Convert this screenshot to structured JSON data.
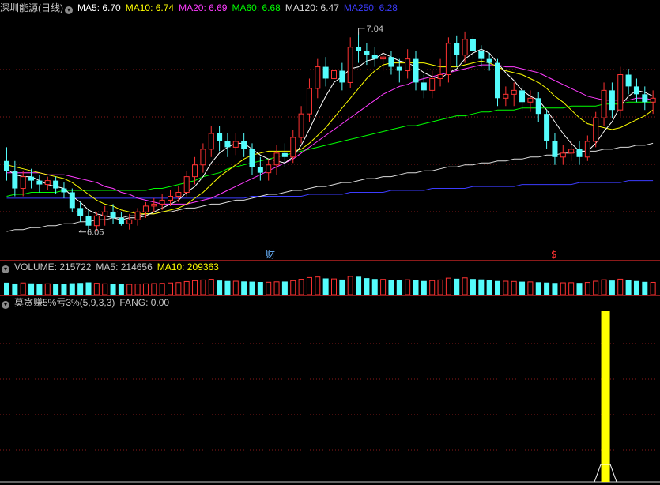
{
  "price_header": {
    "name": "深圳能源",
    "period": "(日线)",
    "ma": [
      {
        "label": "MA5: 6.70",
        "color": "#ffffff"
      },
      {
        "label": "MA10: 6.74",
        "color": "#ffff00"
      },
      {
        "label": "MA20: 6.69",
        "color": "#ff3cff"
      },
      {
        "label": "MA60: 6.68",
        "color": "#00ff00"
      },
      {
        "label": "MA120: 6.47",
        "color": "#dcdcdc"
      },
      {
        "label": "MA250: 6.28",
        "color": "#3c3cff"
      }
    ]
  },
  "volume_header": {
    "volume": "VOLUME: 215722",
    "ma5": "MA5: 214656",
    "ma10": "MA10: 209363"
  },
  "indicator_header": {
    "name": "莫贪赚5%亏3%(5,9,3,3)",
    "value": "FANG: 0.00"
  },
  "markers": {
    "finance": "财",
    "dividend": "$"
  },
  "colors": {
    "up": "#ff3232",
    "down": "#54fcfc",
    "grid": "#8b1a1a",
    "signal": "#ffff00"
  },
  "chart_data": [
    {
      "type": "candlestick",
      "high_label": "7.04",
      "low_label": "6.05",
      "high_value": 7.04,
      "low_value": 6.05,
      "y_range": [
        5.92,
        7.12
      ],
      "candles": [
        [
          6.38,
          6.33,
          6.45,
          6.28
        ],
        [
          6.33,
          6.24,
          6.38,
          6.2
        ],
        [
          6.24,
          6.3,
          6.33,
          6.2
        ],
        [
          6.3,
          6.28,
          6.34,
          6.24
        ],
        [
          6.28,
          6.26,
          6.31,
          6.22
        ],
        [
          6.26,
          6.28,
          6.3,
          6.23
        ],
        [
          6.28,
          6.24,
          6.3,
          6.21
        ],
        [
          6.24,
          6.22,
          6.27,
          6.19
        ],
        [
          6.22,
          6.14,
          6.24,
          6.12
        ],
        [
          6.14,
          6.1,
          6.17,
          6.07
        ],
        [
          6.1,
          6.05,
          6.13,
          6.02
        ],
        [
          6.05,
          6.1,
          6.12,
          6.02
        ],
        [
          6.1,
          6.12,
          6.15,
          6.05
        ],
        [
          6.12,
          6.09,
          6.16,
          6.06
        ],
        [
          6.09,
          6.06,
          6.12,
          6.05
        ],
        [
          6.06,
          6.08,
          6.11,
          6.03
        ],
        [
          6.08,
          6.12,
          6.14,
          6.05
        ],
        [
          6.12,
          6.15,
          6.17,
          6.09
        ],
        [
          6.15,
          6.16,
          6.19,
          6.12
        ],
        [
          6.16,
          6.18,
          6.21,
          6.13
        ],
        [
          6.18,
          6.2,
          6.23,
          6.15
        ],
        [
          6.2,
          6.22,
          6.25,
          6.17
        ],
        [
          6.22,
          6.3,
          6.33,
          6.2
        ],
        [
          6.3,
          6.36,
          6.4,
          6.26
        ],
        [
          6.36,
          6.44,
          6.47,
          6.32
        ],
        [
          6.44,
          6.52,
          6.56,
          6.4
        ],
        [
          6.52,
          6.48,
          6.56,
          6.43
        ],
        [
          6.48,
          6.45,
          6.52,
          6.4
        ],
        [
          6.45,
          6.48,
          6.52,
          6.41
        ],
        [
          6.48,
          6.44,
          6.52,
          6.4
        ],
        [
          6.44,
          6.35,
          6.47,
          6.31
        ],
        [
          6.35,
          6.32,
          6.4,
          6.28
        ],
        [
          6.32,
          6.36,
          6.39,
          6.28
        ],
        [
          6.36,
          6.42,
          6.46,
          6.31
        ],
        [
          6.42,
          6.4,
          6.47,
          6.35
        ],
        [
          6.4,
          6.5,
          6.54,
          6.37
        ],
        [
          6.5,
          6.62,
          6.66,
          6.47
        ],
        [
          6.62,
          6.75,
          6.8,
          6.58
        ],
        [
          6.75,
          6.86,
          6.9,
          6.7
        ],
        [
          6.86,
          6.8,
          6.91,
          6.76
        ],
        [
          6.8,
          6.84,
          6.88,
          6.74
        ],
        [
          6.84,
          6.78,
          6.88,
          6.74
        ],
        [
          6.78,
          6.96,
          7.01,
          6.75
        ],
        [
          6.96,
          6.94,
          7.04,
          6.88
        ],
        [
          6.94,
          6.92,
          6.98,
          6.87
        ],
        [
          6.92,
          6.9,
          6.96,
          6.86
        ],
        [
          6.9,
          6.91,
          6.94,
          6.84
        ],
        [
          6.91,
          6.86,
          6.94,
          6.82
        ],
        [
          6.86,
          6.84,
          6.9,
          6.78
        ],
        [
          6.84,
          6.9,
          6.95,
          6.8
        ],
        [
          6.9,
          6.78,
          6.94,
          6.74
        ],
        [
          6.78,
          6.74,
          6.82,
          6.7
        ],
        [
          6.74,
          6.8,
          6.84,
          6.7
        ],
        [
          6.8,
          6.82,
          6.9,
          6.76
        ],
        [
          6.82,
          6.98,
          7.01,
          6.78
        ],
        [
          6.98,
          6.92,
          7.02,
          6.86
        ],
        [
          6.92,
          7.0,
          7.04,
          6.88
        ],
        [
          7.0,
          6.94,
          7.02,
          6.9
        ],
        [
          6.94,
          6.9,
          6.97,
          6.86
        ],
        [
          6.9,
          6.88,
          6.93,
          6.84
        ],
        [
          6.88,
          6.7,
          6.9,
          6.66
        ],
        [
          6.7,
          6.72,
          6.76,
          6.66
        ],
        [
          6.72,
          6.74,
          6.78,
          6.66
        ],
        [
          6.74,
          6.68,
          6.77,
          6.64
        ],
        [
          6.68,
          6.7,
          6.74,
          6.63
        ],
        [
          6.7,
          6.62,
          6.73,
          6.58
        ],
        [
          6.62,
          6.48,
          6.64,
          6.44
        ],
        [
          6.48,
          6.4,
          6.52,
          6.36
        ],
        [
          6.4,
          6.42,
          6.46,
          6.36
        ],
        [
          6.42,
          6.44,
          6.48,
          6.38
        ],
        [
          6.44,
          6.4,
          6.48,
          6.36
        ],
        [
          6.4,
          6.48,
          6.51,
          6.38
        ],
        [
          6.48,
          6.6,
          6.63,
          6.45
        ],
        [
          6.6,
          6.74,
          6.78,
          6.56
        ],
        [
          6.74,
          6.64,
          6.78,
          6.6
        ],
        [
          6.64,
          6.82,
          6.86,
          6.6
        ],
        [
          6.82,
          6.76,
          6.85,
          6.72
        ],
        [
          6.76,
          6.72,
          6.8,
          6.68
        ],
        [
          6.72,
          6.68,
          6.76,
          6.64
        ],
        [
          6.68,
          6.7,
          6.74,
          6.62
        ]
      ],
      "ma5": [
        6.34,
        6.31,
        6.3,
        6.3,
        6.28,
        6.26,
        6.25,
        6.24,
        6.2,
        6.17,
        6.13,
        6.11,
        6.1,
        6.09,
        6.08,
        6.09,
        6.09,
        6.1,
        6.12,
        6.14,
        6.16,
        6.18,
        6.22,
        6.25,
        6.3,
        6.37,
        6.42,
        6.45,
        6.47,
        6.47,
        6.44,
        6.41,
        6.39,
        6.38,
        6.37,
        6.4,
        6.46,
        6.54,
        6.63,
        6.71,
        6.78,
        6.81,
        6.85,
        6.86,
        6.89,
        6.9,
        6.93,
        6.91,
        6.89,
        6.88,
        6.86,
        6.83,
        6.81,
        6.8,
        6.83,
        6.85,
        6.9,
        6.93,
        6.95,
        6.93,
        6.88,
        6.83,
        6.79,
        6.74,
        6.71,
        6.69,
        6.64,
        6.58,
        6.52,
        6.47,
        6.43,
        6.43,
        6.47,
        6.53,
        6.58,
        6.66,
        6.71,
        6.74,
        6.73,
        6.71
      ],
      "ma10": [
        6.36,
        6.35,
        6.34,
        6.33,
        6.32,
        6.31,
        6.3,
        6.29,
        6.27,
        6.24,
        6.21,
        6.18,
        6.16,
        6.15,
        6.13,
        6.12,
        6.11,
        6.11,
        6.11,
        6.12,
        6.13,
        6.14,
        6.16,
        6.19,
        6.22,
        6.26,
        6.3,
        6.33,
        6.36,
        6.39,
        6.41,
        6.42,
        6.43,
        6.43,
        6.43,
        6.43,
        6.44,
        6.47,
        6.51,
        6.55,
        6.6,
        6.65,
        6.7,
        6.75,
        6.8,
        6.84,
        6.87,
        6.88,
        6.88,
        6.88,
        6.88,
        6.88,
        6.87,
        6.86,
        6.86,
        6.86,
        6.87,
        6.88,
        6.89,
        6.88,
        6.86,
        6.84,
        6.83,
        6.82,
        6.8,
        6.78,
        6.75,
        6.71,
        6.68,
        6.64,
        6.6,
        6.57,
        6.56,
        6.55,
        6.54,
        6.55,
        6.57,
        6.59,
        6.61,
        6.64
      ],
      "ma20": [
        6.32,
        6.32,
        6.32,
        6.32,
        6.32,
        6.31,
        6.31,
        6.31,
        6.3,
        6.29,
        6.28,
        6.27,
        6.25,
        6.24,
        6.22,
        6.21,
        6.19,
        6.18,
        6.17,
        6.16,
        6.16,
        6.16,
        6.16,
        6.17,
        6.18,
        6.19,
        6.21,
        6.23,
        6.25,
        6.27,
        6.29,
        6.31,
        6.33,
        6.35,
        6.37,
        6.39,
        6.42,
        6.45,
        6.48,
        6.51,
        6.54,
        6.57,
        6.6,
        6.63,
        6.66,
        6.69,
        6.72,
        6.74,
        6.76,
        6.77,
        6.79,
        6.8,
        6.81,
        6.82,
        6.83,
        6.84,
        6.85,
        6.86,
        6.87,
        6.87,
        6.87,
        6.86,
        6.86,
        6.85,
        6.84,
        6.83,
        6.81,
        6.79,
        6.77,
        6.75,
        6.73,
        6.71,
        6.7,
        6.69,
        6.69,
        6.69,
        6.69,
        6.7,
        6.7,
        6.69
      ],
      "ma60": [
        6.2,
        6.21,
        6.21,
        6.22,
        6.22,
        6.22,
        6.22,
        6.23,
        6.23,
        6.23,
        6.23,
        6.23,
        6.23,
        6.23,
        6.23,
        6.23,
        6.23,
        6.23,
        6.24,
        6.24,
        6.25,
        6.26,
        6.27,
        6.28,
        6.3,
        6.31,
        6.32,
        6.34,
        6.35,
        6.36,
        6.37,
        6.38,
        6.39,
        6.4,
        6.41,
        6.42,
        6.43,
        6.44,
        6.45,
        6.46,
        6.47,
        6.48,
        6.49,
        6.5,
        6.51,
        6.52,
        6.53,
        6.54,
        6.55,
        6.56,
        6.56,
        6.57,
        6.58,
        6.59,
        6.6,
        6.61,
        6.61,
        6.62,
        6.63,
        6.63,
        6.64,
        6.64,
        6.64,
        6.65,
        6.65,
        6.65,
        6.65,
        6.65,
        6.65,
        6.66,
        6.66,
        6.66,
        6.66,
        6.67,
        6.67,
        6.67,
        6.68,
        6.68,
        6.68,
        6.68
      ],
      "ma120": [
        6.02,
        6.03,
        6.03,
        6.04,
        6.04,
        6.05,
        6.05,
        6.06,
        6.06,
        6.07,
        6.07,
        6.08,
        6.08,
        6.09,
        6.09,
        6.1,
        6.1,
        6.11,
        6.11,
        6.12,
        6.12,
        6.13,
        6.14,
        6.14,
        6.15,
        6.16,
        6.16,
        6.17,
        6.18,
        6.18,
        6.19,
        6.2,
        6.21,
        6.21,
        6.22,
        6.23,
        6.23,
        6.24,
        6.25,
        6.25,
        6.26,
        6.27,
        6.27,
        6.28,
        6.29,
        6.29,
        6.3,
        6.3,
        6.31,
        6.32,
        6.32,
        6.33,
        6.33,
        6.34,
        6.35,
        6.35,
        6.36,
        6.36,
        6.37,
        6.37,
        6.38,
        6.38,
        6.39,
        6.39,
        6.4,
        6.4,
        6.41,
        6.41,
        6.42,
        6.42,
        6.43,
        6.43,
        6.43,
        6.44,
        6.44,
        6.45,
        6.45,
        6.46,
        6.46,
        6.47
      ],
      "ma250": [
        6.19,
        6.19,
        6.19,
        6.19,
        6.19,
        6.19,
        6.19,
        6.19,
        6.19,
        6.19,
        6.19,
        6.19,
        6.19,
        6.19,
        6.19,
        6.19,
        6.19,
        6.19,
        6.19,
        6.19,
        6.19,
        6.19,
        6.19,
        6.19,
        6.19,
        6.19,
        6.19,
        6.19,
        6.19,
        6.19,
        6.2,
        6.2,
        6.2,
        6.2,
        6.2,
        6.2,
        6.2,
        6.21,
        6.21,
        6.21,
        6.21,
        6.21,
        6.22,
        6.22,
        6.22,
        6.22,
        6.22,
        6.23,
        6.23,
        6.23,
        6.23,
        6.23,
        6.24,
        6.24,
        6.24,
        6.24,
        6.24,
        6.25,
        6.25,
        6.25,
        6.25,
        6.25,
        6.25,
        6.26,
        6.26,
        6.26,
        6.26,
        6.26,
        6.26,
        6.26,
        6.27,
        6.27,
        6.27,
        6.27,
        6.27,
        6.27,
        6.28,
        6.28,
        6.28,
        6.28
      ]
    },
    {
      "type": "bar",
      "volumes": [
        210000,
        195000,
        205000,
        198000,
        188000,
        190000,
        186000,
        184000,
        200000,
        205000,
        215000,
        199000,
        190000,
        185000,
        182000,
        180000,
        186000,
        190000,
        194000,
        198000,
        205000,
        212000,
        230000,
        245000,
        258000,
        270000,
        248000,
        240000,
        236000,
        232000,
        228000,
        222000,
        218000,
        225000,
        230000,
        245000,
        270000,
        300000,
        310000,
        285000,
        276000,
        265000,
        320000,
        315000,
        290000,
        275000,
        268000,
        260000,
        250000,
        262000,
        255000,
        240000,
        246000,
        258000,
        290000,
        280000,
        295000,
        275000,
        268000,
        256000,
        240000,
        236000,
        232000,
        228000,
        224000,
        218000,
        212000,
        205000,
        208000,
        210000,
        206000,
        214000,
        236000,
        262000,
        248000,
        272000,
        250000,
        240000,
        225000,
        215722
      ],
      "y_max": 600000
    },
    {
      "type": "bar",
      "signal_bars": [
        {
          "index": 73,
          "value": 100
        }
      ],
      "y_max": 100
    }
  ]
}
